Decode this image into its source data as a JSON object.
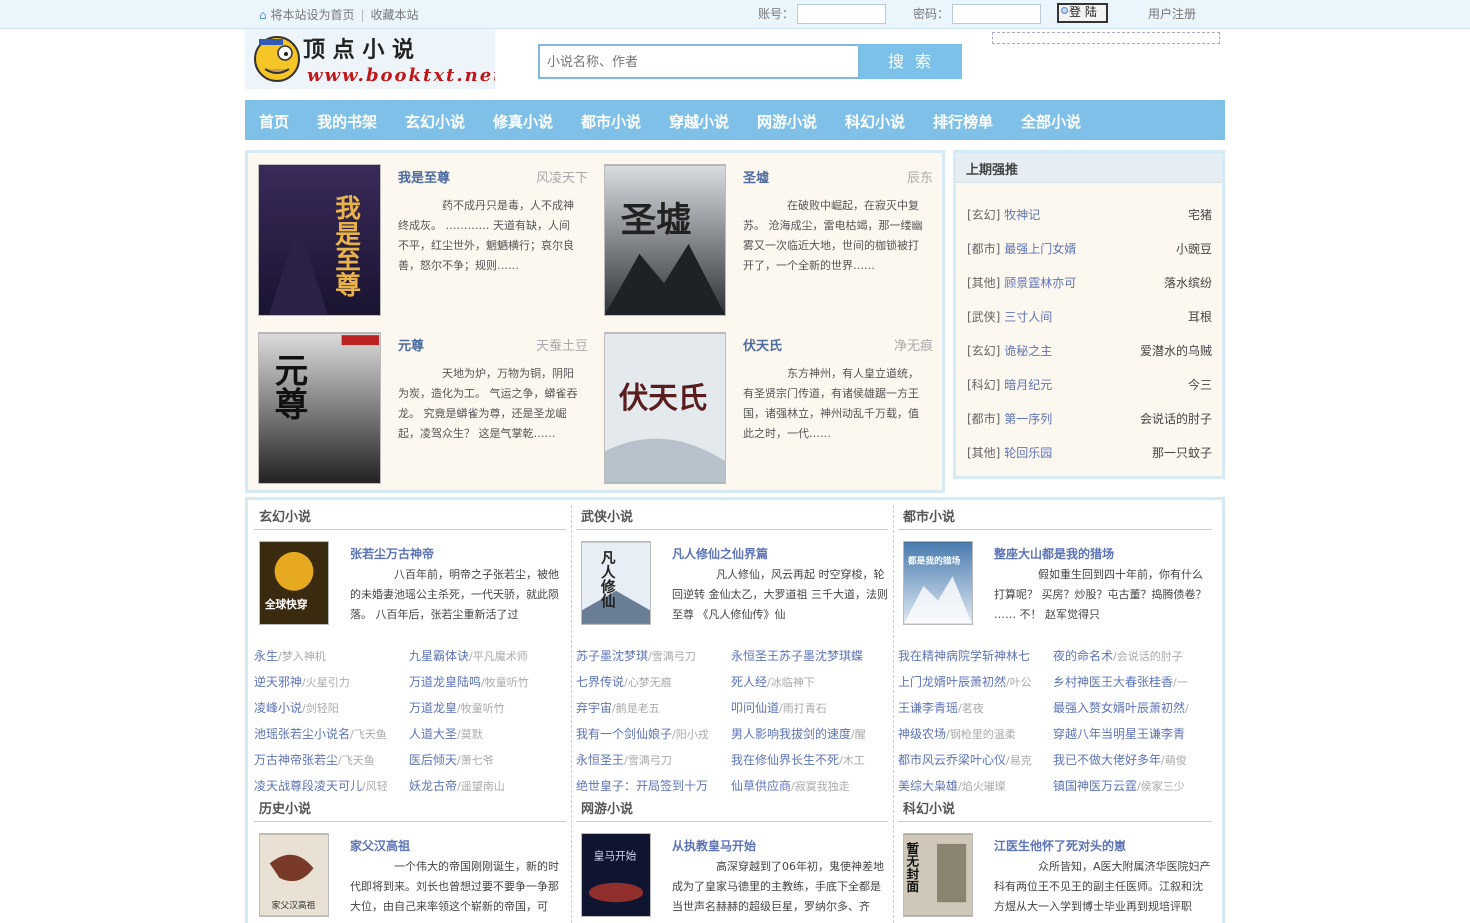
{
  "topbar": {
    "set_home": "将本站设为首页",
    "bookmark": "收藏本站",
    "account_label": "账号：",
    "password_label": "密码：",
    "login_button": "登 陆",
    "register": "用户注册"
  },
  "logo": {
    "name": "顶 点 小 说",
    "url": "www.booktxt.net"
  },
  "search": {
    "placeholder": "小说名称、作者",
    "button": "搜 索"
  },
  "nav": [
    "首页",
    "我的书架",
    "玄幻小说",
    "修真小说",
    "都市小说",
    "穿越小说",
    "网游小说",
    "科幻小说",
    "排行榜单",
    "全部小说"
  ],
  "highlights": [
    {
      "title": "我是至尊",
      "author": "风凌天下",
      "desc": "药不成丹只是毒，人不成神终成灰。 ………… 天道有缺，人间不平，红尘世外，魍魉横行；哀尔良善，怒尔不争；规则……",
      "cover_text": "我是至尊"
    },
    {
      "title": "圣墟",
      "author": "辰东",
      "desc": "在破败中崛起，在寂灭中复苏。 沧海成尘，雷电枯竭，那一缕幽雾又一次临近大地，世间的枷锁被打开了，一个全新的世界……",
      "cover_text": "圣墟"
    },
    {
      "title": "元尊",
      "author": "天蚕土豆",
      "desc": "天地为炉，万物为铜，阴阳为炭，造化为工。 气运之争，蟒雀吞龙。 究竟是蟒雀为尊，还是圣龙崛起，凌驾众生？ 这是气掌乾……",
      "cover_text": "元尊"
    },
    {
      "title": "伏天氏",
      "author": "净无痕",
      "desc": "东方神州，有人皇立道统，有圣贤宗门传道，有诸侯雄踞一方王国，诸强林立，神州动乱千万载，值此之时，一代……",
      "cover_text": "伏天氏"
    }
  ],
  "rank": {
    "title": "上期强推",
    "items": [
      {
        "cat": "[玄幻]",
        "book": "牧神记",
        "author": "宅猪"
      },
      {
        "cat": "[都市]",
        "book": "最强上门女婿",
        "author": "小豌豆"
      },
      {
        "cat": "[其他]",
        "book": "顾景霆林亦可",
        "author": "落水缤纷"
      },
      {
        "cat": "[武侠]",
        "book": "三寸人间",
        "author": "耳根"
      },
      {
        "cat": "[玄幻]",
        "book": "诡秘之主",
        "author": "爱潜水的乌贼"
      },
      {
        "cat": "[科幻]",
        "book": "暗月纪元",
        "author": "今三"
      },
      {
        "cat": "[都市]",
        "book": "第一序列",
        "author": "会说话的肘子"
      },
      {
        "cat": "[其他]",
        "book": "轮回乐园",
        "author": "那一只蚊子"
      }
    ]
  },
  "sections": [
    {
      "title": "玄幻小说",
      "feature": {
        "title": "张若尘万古神帝",
        "desc": "八百年前，明帝之子张若尘，被他的未婚妻池瑶公主杀死，一代天骄，就此陨落。 八百年后，张若尘重新活了过",
        "cover_text": "全球快穿"
      },
      "list": [
        [
          {
            "book": "永生",
            "author": "/梦入神机"
          },
          {
            "book": "九星霸体诀",
            "author": "/平凡魔术师"
          }
        ],
        [
          {
            "book": "逆天邪神",
            "author": "/火星引力"
          },
          {
            "book": "万道龙皇陆鸣",
            "author": "/牧童听竹"
          }
        ],
        [
          {
            "book": "凌峰小说",
            "author": "/剑轻阳"
          },
          {
            "book": "万道龙皇",
            "author": "/牧童听竹"
          }
        ],
        [
          {
            "book": "池瑶张若尘小说名",
            "author": "/飞天鱼"
          },
          {
            "book": "人道大圣",
            "author": "/莫默"
          }
        ],
        [
          {
            "book": "万古神帝张若尘",
            "author": "/飞天鱼"
          },
          {
            "book": "医后倾天",
            "author": "/萧七爷"
          }
        ],
        [
          {
            "book": "凌天战尊段凌天可儿",
            "author": "/风轻"
          },
          {
            "book": "妖龙古帝",
            "author": "/遥望南山"
          }
        ]
      ]
    },
    {
      "title": "武侠小说",
      "feature": {
        "title": "凡人修仙之仙界篇",
        "desc": "凡人修仙，风云再起 时空穿梭，轮回逆转 金仙太乙，大罗道祖 三千大道，法则至尊 《凡人修仙传》仙",
        "cover_text": "凡人修仙"
      },
      "list": [
        [
          {
            "book": "苏子墨沈梦琪",
            "author": "/雪满弓刀"
          },
          {
            "book": "永恒圣王苏子墨沈梦琪蝶",
            "author": ""
          }
        ],
        [
          {
            "book": "七界传说",
            "author": "/心梦无痕"
          },
          {
            "book": "死人经",
            "author": "/冰临神下"
          }
        ],
        [
          {
            "book": "弃宇宙",
            "author": "/鹅是老五"
          },
          {
            "book": "叩问仙道",
            "author": "/雨打青石"
          }
        ],
        [
          {
            "book": "我有一个剑仙娘子",
            "author": "/阳小戎"
          },
          {
            "book": "男人影响我拔剑的速度",
            "author": "/醒"
          }
        ],
        [
          {
            "book": "永恒圣王",
            "author": "/雪满弓刀"
          },
          {
            "book": "我在修仙界长生不死",
            "author": "/木工"
          }
        ],
        [
          {
            "book": "绝世皇子：开局签到十万",
            "author": ""
          },
          {
            "book": "仙草供应商",
            "author": "/寂寞我独走"
          }
        ]
      ]
    },
    {
      "title": "都市小说",
      "feature": {
        "title": "整座大山都是我的猎场",
        "desc": "假如重生回到四十年前，你有什么打算呢？ 买房？炒股？屯古董？捣腾债卷？ …… 不！ 赵军觉得只",
        "cover_text": "都是我的猎场"
      },
      "list": [
        [
          {
            "book": "我在精神病院学斩神林七",
            "author": ""
          },
          {
            "book": "夜的命名术",
            "author": "/会说话的肘子"
          }
        ],
        [
          {
            "book": "上门龙婿叶辰萧初然",
            "author": "/叶公"
          },
          {
            "book": "乡村神医王大春张桂香",
            "author": "/一"
          }
        ],
        [
          {
            "book": "王谦李青瑶",
            "author": "/茗夜"
          },
          {
            "book": "最强入赘女婿叶辰萧初然",
            "author": "/"
          }
        ],
        [
          {
            "book": "神级农场",
            "author": "/钢枪里的温柔"
          },
          {
            "book": "穿越八年当明星王谦李青",
            "author": ""
          }
        ],
        [
          {
            "book": "都市风云乔梁叶心仪",
            "author": "/易克"
          },
          {
            "book": "我已不做大佬好多年",
            "author": "/萌俊"
          }
        ],
        [
          {
            "book": "美综大枭雄",
            "author": "/焰火璀璨"
          },
          {
            "book": "镇国神医万云霆",
            "author": "/侯家三少"
          }
        ]
      ]
    },
    {
      "title": "历史小说",
      "feature": {
        "title": "家父汉高祖",
        "desc": "一个伟大的帝国刚刚诞生，新的时代即将到来。刘长也曾想过要不要争一争那大位，由自己来率领这个崭新的帝国，可",
        "cover_text": "家父汉高祖"
      }
    },
    {
      "title": "网游小说",
      "feature": {
        "title": "从执教皇马开始",
        "desc": "高深穿越到了06年初，鬼使神差地成为了皇家马德里的主教练，手底下全都是当世声名赫赫的超级巨星，罗纳尔多、齐",
        "cover_text": "皇马开始"
      }
    },
    {
      "title": "科幻小说",
      "feature": {
        "title": "江医生他怀了死对头的崽",
        "desc": "众所皆知，A医大附属济华医院妇产科有两位王不见王的副主任医师。江叙和沈方煜从大一入学到博士毕业再到规培评职",
        "cover_text": "暂无封面"
      }
    }
  ]
}
